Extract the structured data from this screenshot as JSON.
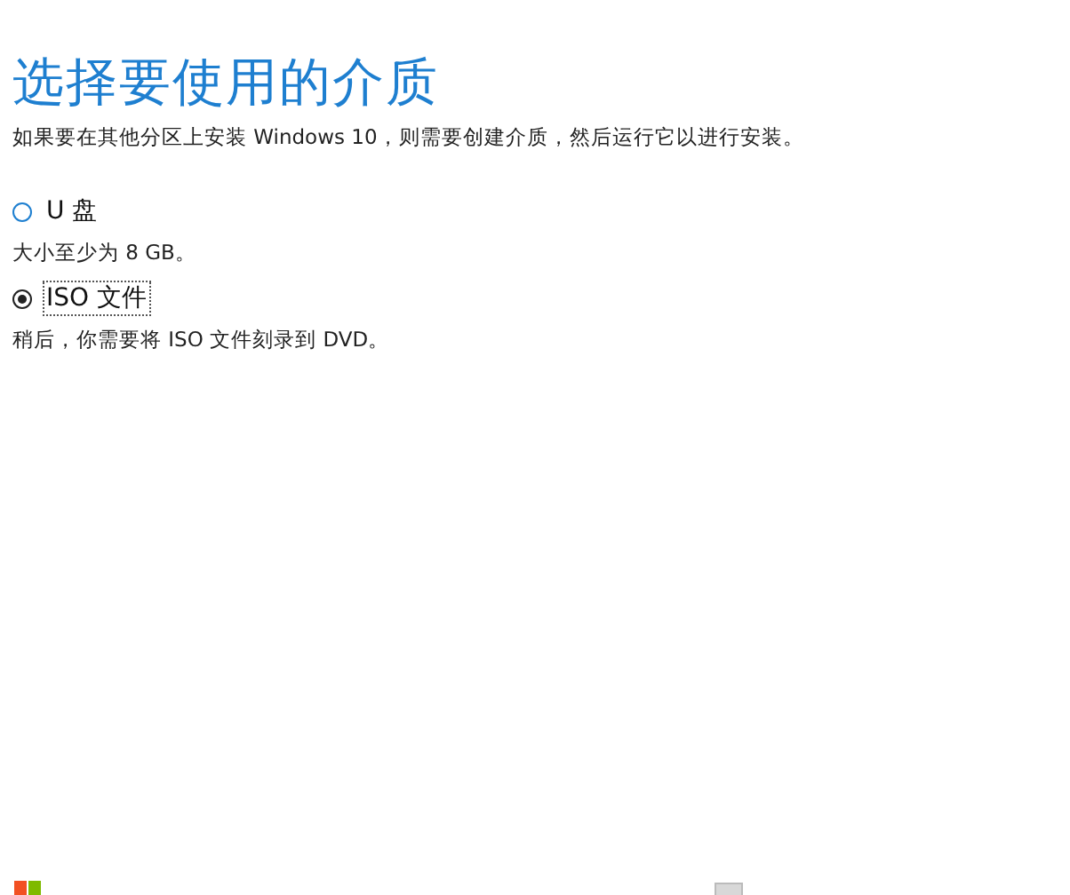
{
  "title": "选择要使用的介质",
  "subtitle": "如果要在其他分区上安装 Windows 10，则需要创建介质，然后运行它以进行安装。",
  "options": [
    {
      "label": "U 盘",
      "description": "大小至少为 8 GB。",
      "selected": false,
      "focused": false
    },
    {
      "label": "ISO 文件",
      "description": "稍后，你需要将 ISO 文件刻录到 DVD。",
      "selected": true,
      "focused": true
    }
  ]
}
